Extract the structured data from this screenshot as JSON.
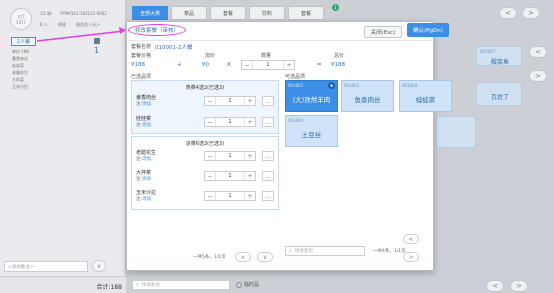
{
  "left_panel": {
    "table_label": "大厅",
    "table_number": "1077",
    "order_no": "YYM0101:182122-0002",
    "time": "15:48",
    "people_label": "6 人",
    "waiter_label": "吧维",
    "order_source_label": "服务员:<无>",
    "selected_set_name": "2人餐",
    "set_items_header": "单价:188",
    "set_items": [
      "番香肉丝",
      "娃娃菜",
      "老醋花生",
      "大拌菜",
      "玉米沙拉"
    ],
    "remark_placeholder": "<添加备注>",
    "total_label": "合计:188",
    "side_price": "1"
  },
  "background_nav": {
    "tabs": [
      "全部大类",
      "菜品",
      "套餐",
      "饮料",
      "套餐"
    ],
    "badge_count": "1",
    "search_placeholder": "快速查询",
    "footer_label": "临时品"
  },
  "background_tiles": [
    {
      "code": "001007",
      "name": "酸菜鱼"
    },
    {
      "code": "",
      "name": "瓦佐丁"
    }
  ],
  "modal": {
    "title": "修改套餐（审核）",
    "close_button": "关闭(Esc)",
    "confirm_button": "确认(PgDn)",
    "set_name_label": "套餐名称",
    "set_name_value": "010001-2人餐",
    "set_price_label": "套餐价格",
    "extra_price_label": "加价",
    "quantity_label": "数量",
    "total_label": "总价",
    "set_price_value": "¥188",
    "plus_sign": "+",
    "extra_price_value": "¥0",
    "times_sign": "X",
    "quantity_value": "1",
    "equals_sign": "=",
    "total_value": "¥188",
    "selected_section_label": "已选品项",
    "available_section_label": "可选品项",
    "groups": [
      {
        "title": "热菜4选2(已选2)",
        "dishes": [
          {
            "name": "番香肉丝",
            "note_label": "注:",
            "note_action": "添加",
            "qty": "1"
          },
          {
            "name": "娃娃菜",
            "note_label": "注:",
            "note_action": "添加",
            "qty": "1"
          }
        ]
      },
      {
        "title": "凉菜6选3(已选3)",
        "dishes": [
          {
            "name": "老醋花生",
            "note_label": "注:",
            "note_action": "添加",
            "qty": "1"
          },
          {
            "name": "大拌菜",
            "note_label": "注:",
            "note_action": "添加",
            "qty": "1"
          },
          {
            "name": "玉米沙拉",
            "note_label": "注:",
            "note_action": "添加",
            "qty": "1"
          }
        ]
      }
    ],
    "available_items": [
      {
        "code": "001001",
        "name": "(大)孜然羊肉",
        "selected": true
      },
      {
        "code": "001002",
        "name": "鱼香肉丝",
        "selected": false
      },
      {
        "code": "001003",
        "name": "蛙蛙菜",
        "selected": false
      },
      {
        "code": "001004",
        "name": "土豆丝",
        "selected": false
      }
    ],
    "left_pager": "一共5条，1/1页",
    "right_pager": "一共4条，1/1页",
    "search_placeholder": "快速查询"
  }
}
